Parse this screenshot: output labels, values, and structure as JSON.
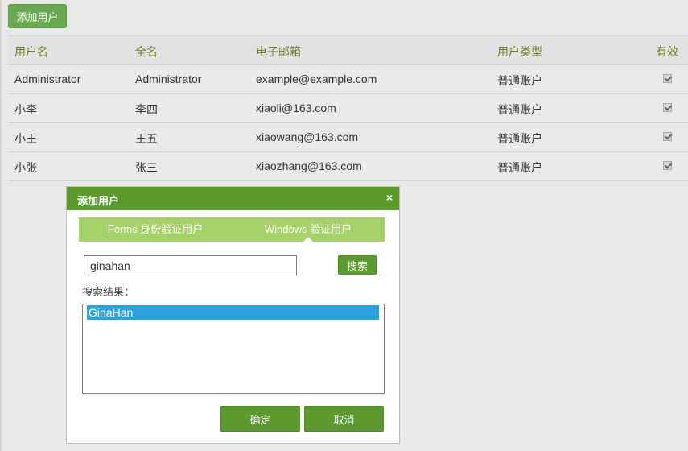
{
  "toolbar": {
    "add_user_label": "添加用户"
  },
  "table": {
    "columns": [
      "用户名",
      "全名",
      "电子邮箱",
      "用户类型",
      "有效"
    ],
    "rows": [
      {
        "username": "Administrator",
        "fullname": "Administrator",
        "email": "example@example.com",
        "type": "普通账户",
        "active": true
      },
      {
        "username": "小李",
        "fullname": "李四",
        "email": "xiaoli@163.com",
        "type": "普通账户",
        "active": true
      },
      {
        "username": "小王",
        "fullname": "王五",
        "email": "xiaowang@163.com",
        "type": "普通账户",
        "active": true
      },
      {
        "username": "小张",
        "fullname": "张三",
        "email": "xiaozhang@163.com",
        "type": "普通账户",
        "active": true
      }
    ]
  },
  "dialog": {
    "title": "添加用户",
    "close_icon": "×",
    "tabs": [
      {
        "label": "Forms 身份验证用户",
        "active": false
      },
      {
        "label": "Windows 验证用户",
        "active": true
      }
    ],
    "search": {
      "value": "ginahan",
      "button_label": "搜索"
    },
    "results_label": "搜索结果：",
    "results": [
      "GinaHan"
    ],
    "ok_label": "确定",
    "cancel_label": "取消"
  },
  "colors": {
    "primary_green": "#5b9b2d",
    "tab_green": "#a6d169",
    "header_text": "#6b7d2b",
    "selection_blue": "#2aa2db"
  },
  "icons": {
    "close": "close-icon",
    "checkbox": "checkbox-checked-icon"
  }
}
